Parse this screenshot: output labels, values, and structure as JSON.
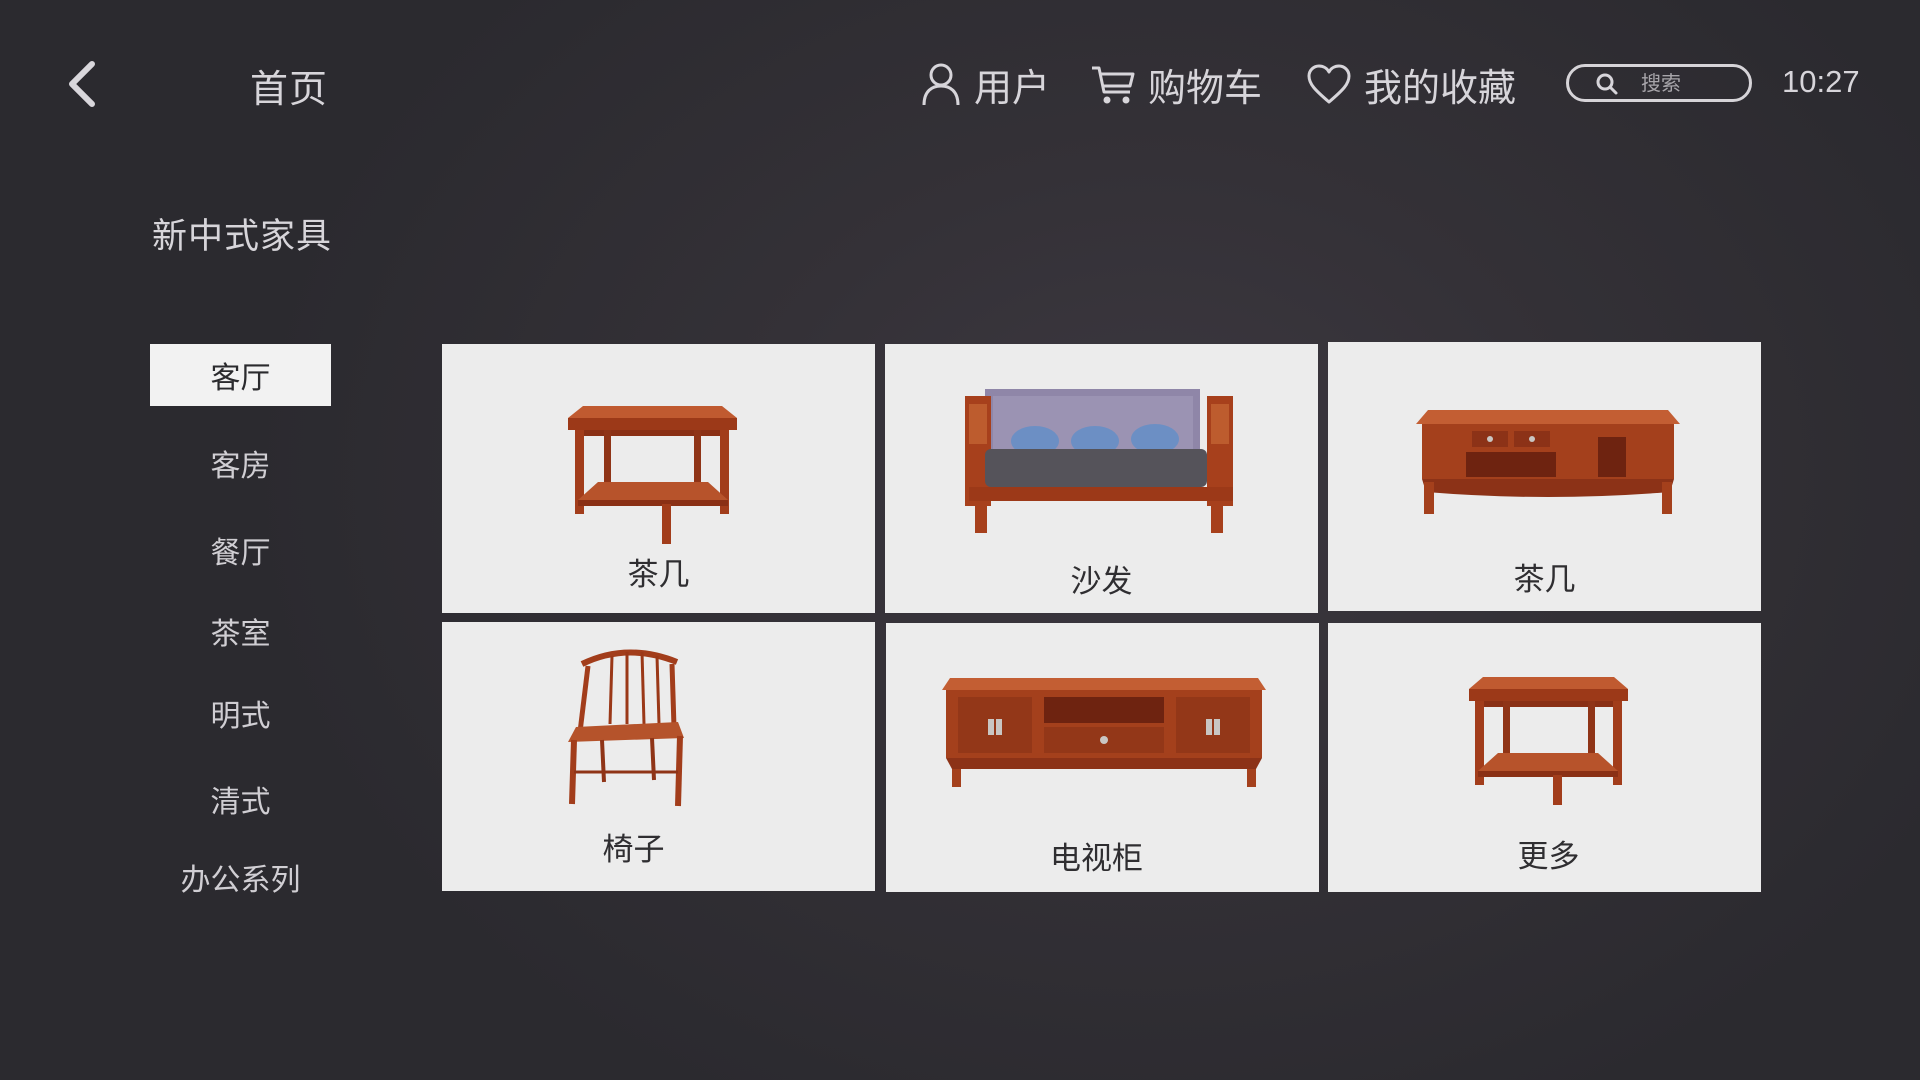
{
  "header": {
    "back_icon": "chevron-left-icon",
    "title": "首页",
    "nav": [
      {
        "label": "用户",
        "icon": "user-icon"
      },
      {
        "label": "购物车",
        "icon": "cart-icon"
      },
      {
        "label": "我的收藏",
        "icon": "heart-icon"
      }
    ],
    "search": {
      "placeholder": "搜索",
      "value": "",
      "icon": "search-icon"
    },
    "time": "10:27"
  },
  "sidebar": {
    "category_title": "新中式家具",
    "items": [
      {
        "label": "客厅",
        "active": true
      },
      {
        "label": "客房",
        "active": false
      },
      {
        "label": "餐厅",
        "active": false
      },
      {
        "label": "茶室",
        "active": false
      },
      {
        "label": "明式",
        "active": false
      },
      {
        "label": "清式",
        "active": false
      },
      {
        "label": "办公系列",
        "active": false
      }
    ]
  },
  "products": [
    {
      "label": "茶几",
      "image": "square-tea-table"
    },
    {
      "label": "沙发",
      "image": "sofa"
    },
    {
      "label": "茶几",
      "image": "rectangular-tea-table"
    },
    {
      "label": "椅子",
      "image": "chair"
    },
    {
      "label": "电视柜",
      "image": "tv-cabinet"
    },
    {
      "label": "更多",
      "image": "square-tea-table"
    }
  ],
  "colors": {
    "background": "#333136",
    "card_bg": "#ececec",
    "active_tab_bg": "#f2f2f2",
    "wood": "#a7401c",
    "text_light": "#d7d5da",
    "text_dark": "#2f2e31"
  }
}
